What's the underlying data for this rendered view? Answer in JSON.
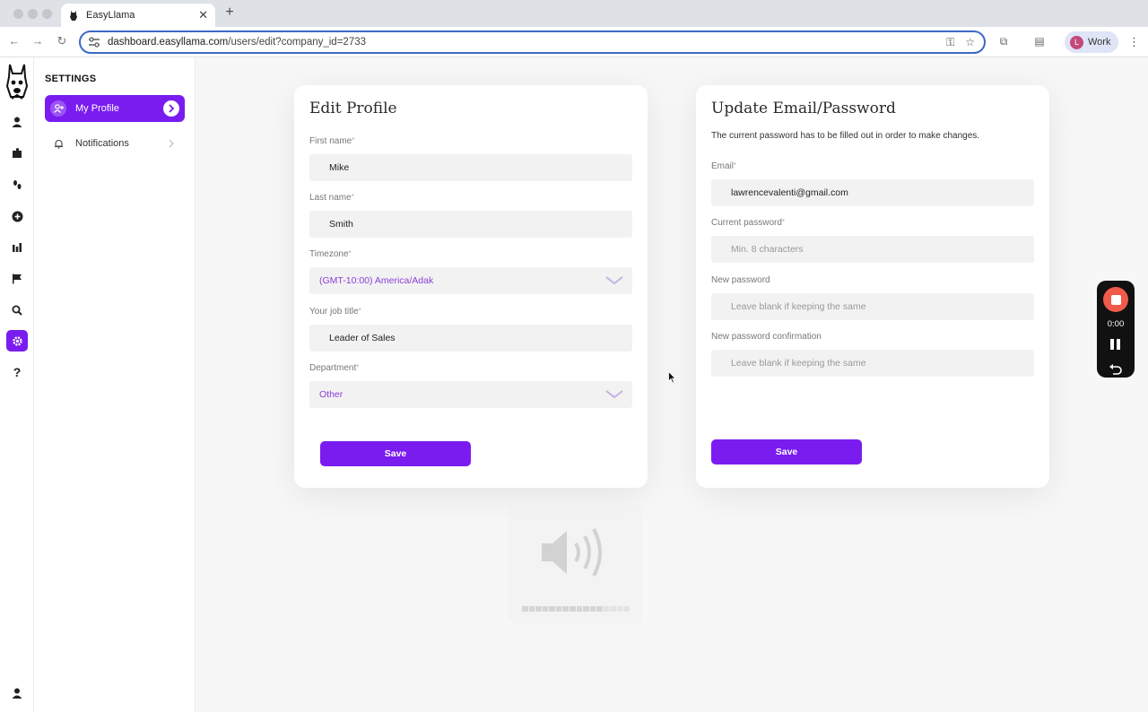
{
  "browser": {
    "tab_title": "EasyLlama",
    "url_host": "dashboard.easyllama.com",
    "url_path": "/users/edit?company_id=2733",
    "profile_initial": "L",
    "profile_label": "Work"
  },
  "sidebar": {
    "title": "SETTINGS",
    "items": [
      {
        "label": "My Profile",
        "active": true
      },
      {
        "label": "Notifications",
        "active": false
      }
    ]
  },
  "rail_icons": [
    "user-icon",
    "puzzle-icon",
    "steps-icon",
    "plus-circle-icon",
    "bar-chart-icon",
    "flag-icon",
    "search-icon",
    "gear-icon",
    "help-icon"
  ],
  "edit_profile": {
    "title": "Edit Profile",
    "first_name_label": "First name",
    "first_name_value": "Mike",
    "last_name_label": "Last name",
    "last_name_value": "Smith",
    "timezone_label": "Timezone",
    "timezone_value": "(GMT-10:00) America/Adak",
    "job_title_label": "Your job title",
    "job_title_value": "Leader of Sales",
    "department_label": "Department",
    "department_value": "Other",
    "save_label": "Save"
  },
  "update_email": {
    "title": "Update Email/Password",
    "description": "The current password has to be filled out in order to make changes.",
    "email_label": "Email",
    "email_value": "lawrencevalenti@gmail.com",
    "current_password_label": "Current password",
    "current_password_placeholder": "Min. 8 characters",
    "new_password_label": "New password",
    "new_password_placeholder": "Leave blank if keeping the same",
    "confirm_label": "New password confirmation",
    "confirm_placeholder": "Leave blank if keeping the same",
    "save_label": "Save"
  },
  "required_marker": "*",
  "recorder": {
    "time": "0:00"
  },
  "volume_level": 0.75,
  "colors": {
    "accent": "#7a1cf0",
    "recorder_stop": "#f05a4a"
  }
}
